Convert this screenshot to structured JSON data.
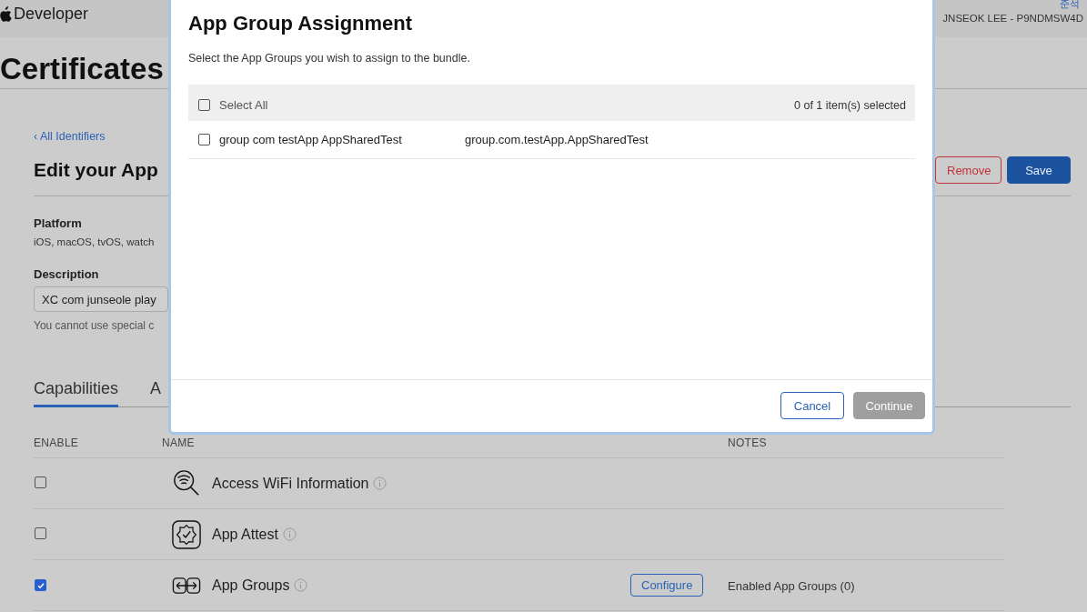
{
  "header": {
    "brand": "Developer",
    "account_link": "준석",
    "account": "JNSEOK LEE - P9NDMSW4D"
  },
  "page_title": "Certificates",
  "back_link": "‹ All Identifiers",
  "heading": "Edit your App",
  "actions": [
    {
      "label": "Remove",
      "kind": "danger"
    },
    {
      "label": "Save",
      "kind": "primary"
    }
  ],
  "platform": {
    "label": "Platform",
    "value": "iOS, macOS, tvOS, watch"
  },
  "description": {
    "label": "Description",
    "value": "XC com junseole play",
    "hint": "You cannot use special c"
  },
  "tabs": [
    {
      "label": "Capabilities",
      "selected": true
    },
    {
      "label": "A",
      "selected": false
    }
  ],
  "columns": [
    "ENABLE",
    "NAME",
    "NOTES"
  ],
  "capabilities": [
    {
      "name": "Access WiFi Information",
      "enabled": false
    },
    {
      "name": "App Attest",
      "enabled": false
    },
    {
      "name": "App Groups",
      "enabled": true,
      "action": "Configure",
      "notes": "Enabled App Groups (0)"
    }
  ],
  "modal": {
    "title": "App Group Assignment",
    "subtitle": "Select the App Groups you wish to assign to the bundle.",
    "select_all": {
      "label": "Select All",
      "checked": false
    },
    "count": "0 of 1 item(s) selected",
    "groups": [
      {
        "name": "group com testApp AppSharedTest",
        "identifier": "group.com.testApp.AppSharedTest",
        "checked": false
      }
    ],
    "buttons": [
      {
        "label": "Cancel",
        "kind": "secondary",
        "disabled": false
      },
      {
        "label": "Continue",
        "kind": "primary",
        "disabled": true
      }
    ]
  }
}
